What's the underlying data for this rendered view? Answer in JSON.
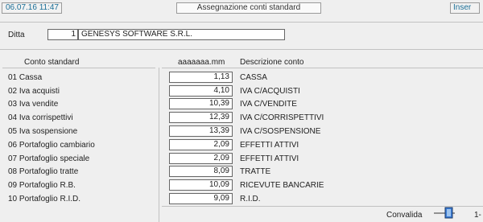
{
  "header": {
    "datetime": "06.07.16 11:47",
    "title": "Assegnazione conti standard",
    "mode": "Inser"
  },
  "ditta": {
    "label": "Ditta",
    "code": "1",
    "name": "GENESYS SOFTWARE S.R.L."
  },
  "columns": {
    "conto": "Conto standard",
    "account": "aaaaaaa.mm",
    "descrizione": "Descrizione conto"
  },
  "rows": [
    {
      "label": "01 Cassa",
      "value": "1,13",
      "desc": "CASSA"
    },
    {
      "label": "02 Iva acquisti",
      "value": "4,10",
      "desc": "IVA C/ACQUISTI"
    },
    {
      "label": "03 Iva vendite",
      "value": "10,39",
      "desc": "IVA C/VENDITE"
    },
    {
      "label": "04 Iva corrispettivi",
      "value": "12,39",
      "desc": "IVA C/CORRISPETTIVI"
    },
    {
      "label": "05 Iva sospensione",
      "value": "13,39",
      "desc": "IVA C/SOSPENSIONE"
    },
    {
      "label": "06 Portafoglio cambiario",
      "value": "2,09",
      "desc": "EFFETTI ATTIVI"
    },
    {
      "label": "07 Portafoglio speciale",
      "value": "2,09",
      "desc": "EFFETTI ATTIVI"
    },
    {
      "label": "08 Portafoglio tratte",
      "value": "8,09",
      "desc": "TRATTE"
    },
    {
      "label": "09 Portafoglio R.B.",
      "value": "10,09",
      "desc": "RICEVUTE BANCARIE"
    },
    {
      "label": "10 Portafoglio R.I.D.",
      "value": "9,09",
      "desc": "R.I.D."
    }
  ],
  "footer": {
    "convalida": "Convalida",
    "icon": "confirm-toggle-icon",
    "trailing": "1-"
  },
  "colors": {
    "accent": "#1a6e96",
    "background": "#efefef"
  }
}
